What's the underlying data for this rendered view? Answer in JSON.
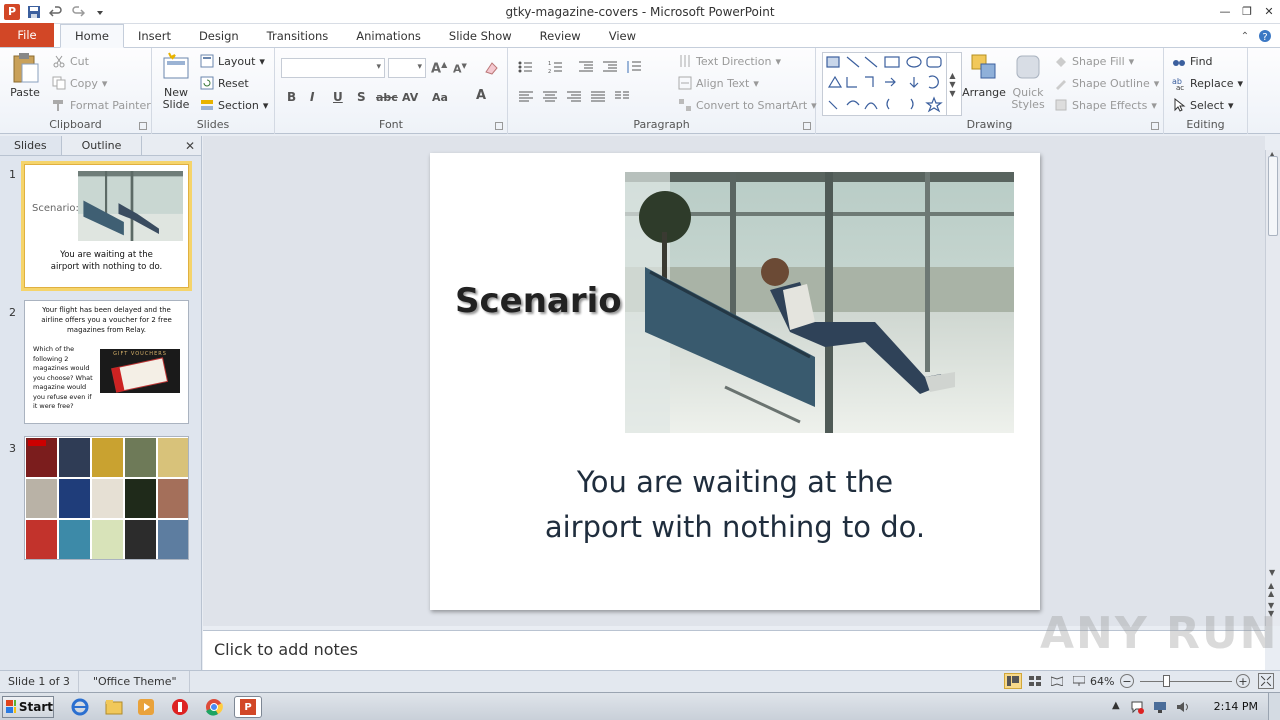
{
  "window": {
    "title": "gtky-magazine-covers  -  Microsoft PowerPoint",
    "app_icon_letter": "P"
  },
  "tabs": [
    "File",
    "Home",
    "Insert",
    "Design",
    "Transitions",
    "Animations",
    "Slide Show",
    "Review",
    "View"
  ],
  "active_tab": "Home",
  "ribbon": {
    "clipboard": {
      "label": "Clipboard",
      "paste": "Paste",
      "cut": "Cut",
      "copy": "Copy",
      "format_painter": "Format Painter"
    },
    "slides": {
      "label": "Slides",
      "new_slide": "New\nSlide",
      "new_slide_line1": "New",
      "new_slide_line2": "Slide",
      "layout": "Layout",
      "reset": "Reset",
      "section": "Section"
    },
    "font": {
      "label": "Font",
      "bold": "B",
      "italic": "I",
      "underline": "U",
      "shadow": "S",
      "strike": "abc",
      "spacing": "AV",
      "case": "Aa",
      "color": "A"
    },
    "paragraph": {
      "label": "Paragraph",
      "text_direction": "Text Direction",
      "align_text": "Align Text",
      "convert_smartart": "Convert to SmartArt"
    },
    "drawing": {
      "label": "Drawing",
      "arrange": "Arrange",
      "quick_styles_line1": "Quick",
      "quick_styles_line2": "Styles",
      "shape_fill": "Shape Fill",
      "shape_outline": "Shape Outline",
      "shape_effects": "Shape Effects"
    },
    "editing": {
      "label": "Editing",
      "find": "Find",
      "replace": "Replace",
      "select": "Select"
    }
  },
  "pane": {
    "tabs": [
      "Slides",
      "Outline"
    ],
    "active": "Slides",
    "thumbnails": [
      {
        "number": "1",
        "scenario": "Scenario:",
        "text_line1": "You are waiting at the",
        "text_line2": "airport with nothing to do."
      },
      {
        "number": "2",
        "heading": "Your flight has been delayed and the airline offers you a voucher for 2 free magazines from Relay.",
        "body": "Which of the following 2 magazines would you choose? What magazine would you refuse even if it were free?",
        "voucher_label": "GIFT VOUCHERS"
      },
      {
        "number": "3"
      }
    ]
  },
  "slide": {
    "heading": "Scenario:",
    "body_line1": "You are waiting at the",
    "body_line2": "airport with nothing to do."
  },
  "notes": {
    "placeholder": "Click to add notes"
  },
  "status": {
    "slide_counter": "Slide 1 of 3",
    "theme": "\"Office Theme\"",
    "zoom": "64%"
  },
  "taskbar": {
    "start": "Start",
    "clock": "2:14 PM"
  },
  "watermark": "ANY RUN",
  "colors": {
    "file_tab": "#d24726",
    "selected_thumb": "#f5d46b",
    "slide_text": "#1f2d3d"
  }
}
